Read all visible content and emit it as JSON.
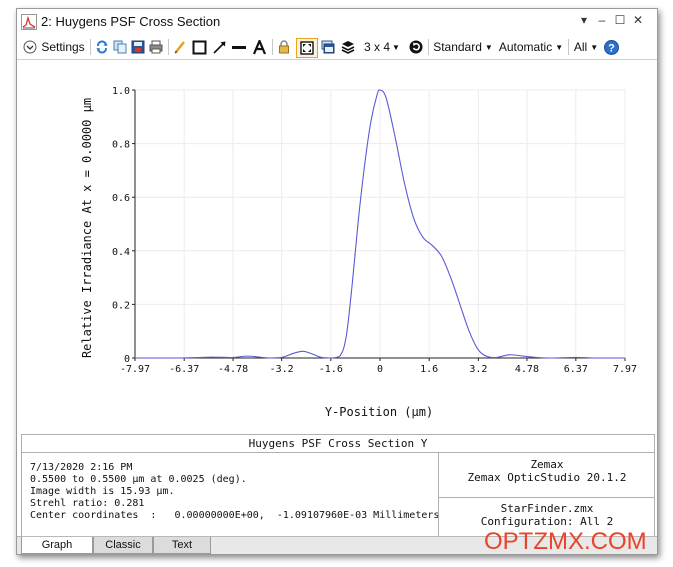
{
  "window": {
    "title": "2: Huygens PSF Cross Section",
    "controls": [
      "▾",
      "–",
      "☐",
      "✕"
    ]
  },
  "toolbar": {
    "settings_label": "Settings",
    "layout_label": "3 x 4",
    "standard_label": "Standard",
    "automatic_label": "Automatic",
    "all_label": "All",
    "help_label": "?"
  },
  "chart_data": {
    "type": "line",
    "title": "",
    "xlabel": "Y-Position (µm)",
    "ylabel": "Relative Irradiance At x = 0.0000 µm",
    "xlim": [
      -7.97,
      7.97
    ],
    "ylim": [
      0,
      1.0
    ],
    "xticks": [
      -7.97,
      -6.37,
      -4.78,
      -3.2,
      -1.6,
      0,
      1.6,
      3.2,
      4.78,
      6.37,
      7.97
    ],
    "xtick_labels": [
      "-7.97",
      "-6.37",
      "-4.78",
      "-3.2",
      "-1.6",
      "0",
      "1.6",
      "3.2",
      "4.78",
      "6.37",
      "7.97"
    ],
    "yticks": [
      0,
      0.2,
      0.4,
      0.6,
      0.8,
      1.0
    ],
    "ytick_labels": [
      "0",
      "0.2",
      "0.4",
      "0.6",
      "0.8",
      "1.0"
    ],
    "grid": true,
    "line_color": "#5a5ad6",
    "series": [
      {
        "x": [
          -7.97,
          -6.5,
          -5.5,
          -4.78,
          -4.3,
          -3.6,
          -3.2,
          -2.8,
          -2.5,
          -2.2,
          -1.9,
          -1.6,
          -1.3,
          -1.1,
          -0.9,
          -0.7,
          -0.5,
          -0.3,
          -0.1,
          0,
          0.2,
          0.5,
          0.8,
          1.1,
          1.4,
          1.7,
          2.0,
          2.3,
          2.6,
          2.9,
          3.2,
          3.5,
          3.8,
          4.2,
          4.6,
          5.0,
          5.5,
          6.37,
          7.0,
          7.97
        ],
        "y": [
          0.0,
          0.0,
          0.003,
          0.002,
          0.007,
          0.0,
          0.002,
          0.018,
          0.025,
          0.015,
          0.002,
          0.0,
          0.008,
          0.08,
          0.28,
          0.52,
          0.72,
          0.88,
          0.98,
          1.0,
          0.97,
          0.82,
          0.65,
          0.52,
          0.45,
          0.42,
          0.38,
          0.3,
          0.2,
          0.1,
          0.03,
          0.005,
          0.002,
          0.012,
          0.008,
          0.003,
          0.0,
          0.002,
          0.0,
          0.0
        ]
      }
    ]
  },
  "info": {
    "header": "Huygens PSF Cross Section Y",
    "lines": [
      "7/13/2020 2:16 PM",
      "0.5500 to 0.5500 µm at 0.0025 (deg).",
      "Image width is 15.93 µm.",
      "Strehl ratio: 0.281",
      "Center coordinates  :   0.00000000E+00,  -1.09107960E-03 Millimeters"
    ],
    "company": "Zemax",
    "product": "Zemax OpticStudio 20.1.2",
    "file": "StarFinder.zmx",
    "configuration": "Configuration: All 2"
  },
  "tabs": [
    {
      "label": "Graph",
      "active": true
    },
    {
      "label": "Classic",
      "active": false
    },
    {
      "label": "Text",
      "active": false
    }
  ],
  "watermark": "OPTZMX.COM",
  "colors": {
    "curve": "#5a5ad6",
    "watermark": "#e8442a",
    "highlight_border": "#e8a21c"
  }
}
